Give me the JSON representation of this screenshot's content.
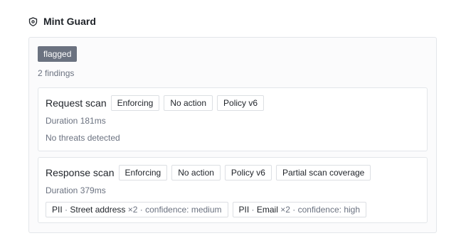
{
  "header": {
    "title": "Mint Guard",
    "icon": "shield-icon"
  },
  "panel": {
    "status_badge": "flagged",
    "findings_count": "2 findings",
    "request": {
      "title": "Request scan",
      "chips": [
        "Enforcing",
        "No action",
        "Policy v6"
      ],
      "duration": "Duration 181ms",
      "result": "No threats detected"
    },
    "response": {
      "title": "Response scan",
      "chips": [
        "Enforcing",
        "No action",
        "Policy v6",
        "Partial scan coverage"
      ],
      "duration": "Duration 379ms",
      "findings": [
        {
          "type": "PII",
          "separator": "·",
          "entity": "Street address",
          "multiplier": "×2",
          "confidence": "confidence: medium"
        },
        {
          "type": "PII",
          "separator": "·",
          "entity": "Email",
          "multiplier": "×2",
          "confidence": "confidence: high"
        }
      ]
    }
  },
  "colors": {
    "badge_bg": "#6b7280",
    "muted_text": "#6b7280",
    "border": "#e3e6ea"
  }
}
